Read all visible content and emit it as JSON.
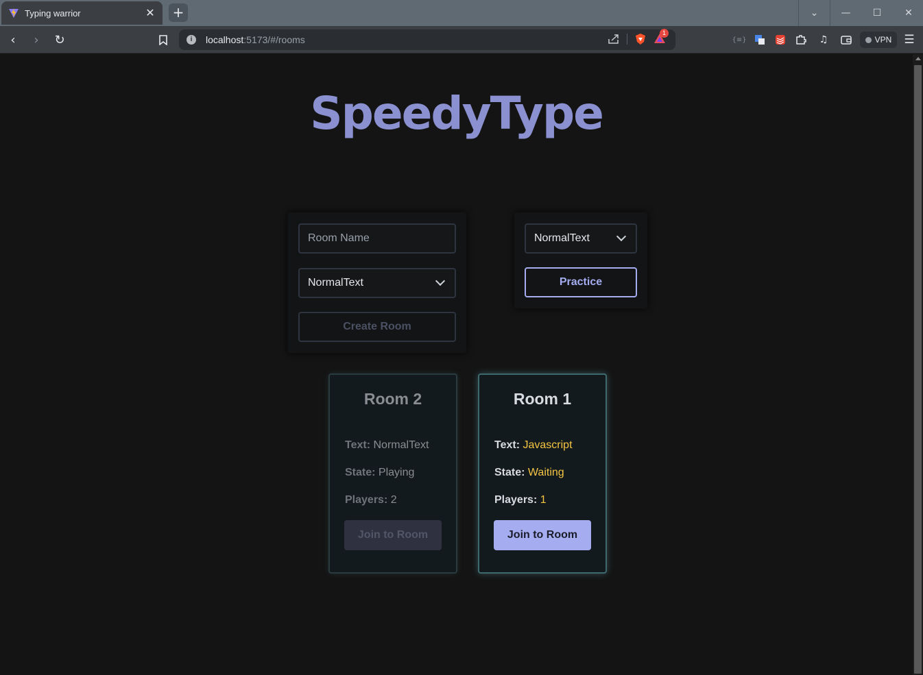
{
  "browser": {
    "tab_title": "Typing warrior",
    "url_host": "localhost",
    "url_rest": ":5173/#/rooms",
    "vpn_label": "VPN",
    "notification_count": "1"
  },
  "app": {
    "logo": "SpeedyType"
  },
  "create_panel": {
    "room_name_placeholder": "Room Name",
    "text_type_selected": "NormalText",
    "create_button": "Create Room"
  },
  "practice_panel": {
    "text_type_selected": "NormalText",
    "practice_button": "Practice"
  },
  "rooms": [
    {
      "name": "Room 2",
      "text_label": "Text:",
      "text_value": "NormalText",
      "state_label": "State:",
      "state_value": "Playing",
      "players_label": "Players:",
      "players_value": "2",
      "join_label": "Join to Room",
      "enabled": false
    },
    {
      "name": "Room 1",
      "text_label": "Text:",
      "text_value": "Javascript",
      "state_label": "State:",
      "state_value": "Waiting",
      "players_label": "Players:",
      "players_value": "1",
      "join_label": "Join to Room",
      "enabled": true
    }
  ],
  "colors": {
    "accent": "#a5adf0",
    "logo": "#8b91d0",
    "highlight_value": "#f5c542",
    "background": "#141414"
  }
}
